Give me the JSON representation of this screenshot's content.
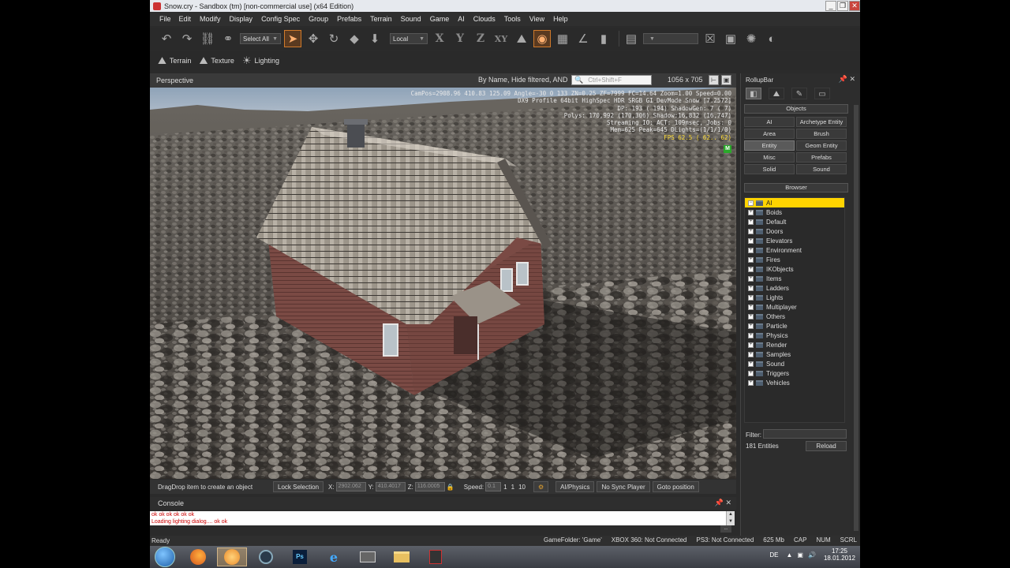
{
  "window": {
    "title": "Snow.cry - Sandbox (tm) [non-commercial use] (x64 Edition)",
    "controls": [
      "_",
      "❐",
      "✕"
    ]
  },
  "menu": [
    "File",
    "Edit",
    "Modify",
    "Display",
    "Config Spec",
    "Group",
    "Prefabs",
    "Terrain",
    "Sound",
    "Game",
    "AI",
    "Clouds",
    "Tools",
    "View",
    "Help"
  ],
  "toolbar": {
    "selection_mask": "Select All",
    "coord_system": "Local",
    "axes": [
      "X",
      "Y",
      "Z",
      "XY"
    ]
  },
  "toolbar2": [
    {
      "label": "Terrain",
      "icon": "terrain-icon"
    },
    {
      "label": "Texture",
      "icon": "texture-icon"
    },
    {
      "label": "Lighting",
      "icon": "lighting-icon"
    }
  ],
  "viewport": {
    "title": "Perspective",
    "filter_text": "By Name, Hide filtered, AND",
    "search_placeholder": "Ctrl+Shift+F",
    "resolution": "1056 x 705",
    "stats": [
      "CamPos=2908.96 410.83 125.09 Angle=-30  0 133 ZN=0.25 ZF=7999 FC=14.64 Zoom=1.00 Speed=0.00",
      "DX9 Profile 64bit HighSpec HDR SRGB GI DevMode Snow [7.2572]",
      "DP:  193 ( 194) ShadowGen:  7 (  7)",
      "Polys: 170,992 (170,306) Shadow:16,832 (16,747)",
      "Streaming IO: ACT: 109msec, Jobs: 0",
      "Mem=625 Peak=645 DLights=(1/1/1/0)"
    ],
    "fps": "FPS  62.5 ( 62.. 62)",
    "mode_badge": "M"
  },
  "viewport_status": {
    "tip": "DragDrop item to create an object",
    "lock_selection": "Lock Selection",
    "x_label": "X:",
    "x_value": "2902.062",
    "y_label": "Y:",
    "y_value": "410.4017",
    "z_label": "Z:",
    "z_value": "116.0005",
    "speed_label": "Speed:",
    "speed_value": "0.1",
    "speed_presets": [
      "1",
      "1",
      "10"
    ],
    "ai_physics": "AI/Physics",
    "no_sync_player": "No Sync Player",
    "goto_position": "Goto position"
  },
  "console": {
    "title": "Console",
    "lines": [
      "ok ok ok ok ok ok",
      "Loading lighting dialog.... ok ok"
    ]
  },
  "statusbar": {
    "left": "Ready",
    "gamefolder": "GameFolder: 'Game'",
    "xbox": "XBOX 360: Not Connected",
    "ps3": "PS3: Not Connected",
    "memory": "625 Mb",
    "caps": "CAP",
    "num": "NUM",
    "scrl": "SCRL"
  },
  "rollup": {
    "title": "RollupBar",
    "objects_header": "Objects",
    "object_buttons": [
      [
        "AI",
        "Archetype Entity"
      ],
      [
        "Area",
        "Brush"
      ],
      [
        "Entity",
        "Geom Entity"
      ],
      [
        "Misc",
        "Prefabs"
      ],
      [
        "Solid",
        "Sound"
      ]
    ],
    "browser_header": "Browser",
    "tree": [
      "AI",
      "Boids",
      "Default",
      "Doors",
      "Elevators",
      "Environment",
      "Fires",
      "IKObjects",
      "Items",
      "Ladders",
      "Lights",
      "Multiplayer",
      "Others",
      "Particle",
      "Physics",
      "Render",
      "Samples",
      "Sound",
      "Triggers",
      "Vehicles"
    ],
    "filter_label": "Filter:",
    "entity_count": "181 Entities",
    "reload": "Reload"
  },
  "taskbar": {
    "language": "DE",
    "time": "17:25",
    "date": "18.01.2012",
    "apps": [
      "firefox-icon",
      "browser-icon",
      "steam-icon",
      "photoshop-icon",
      "ie-icon",
      "app-icon",
      "explorer-icon",
      "sandbox-icon"
    ]
  }
}
